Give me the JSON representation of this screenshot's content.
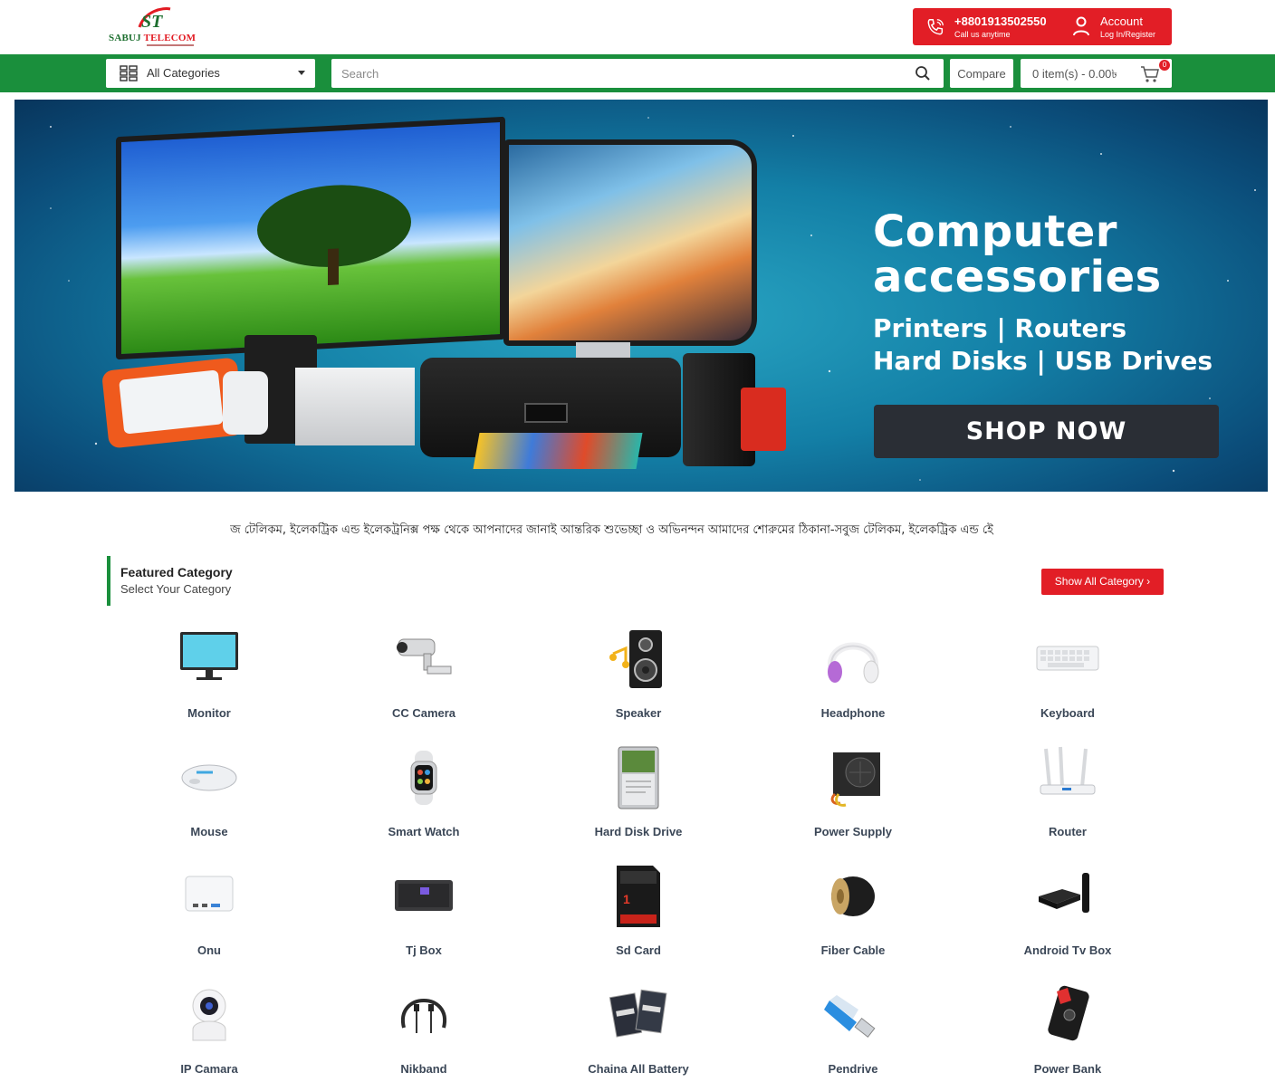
{
  "header": {
    "logo_text_1": "SABUJ",
    "logo_text_2": "TELECOM",
    "phone": "+8801913502550",
    "phone_sub": "Call us anytime",
    "account_label": "Account",
    "account_sub": "Log In/Register"
  },
  "nav": {
    "category_select": "All Categories",
    "search_placeholder": "Search",
    "compare_label": "Compare",
    "cart_text": "0 item(s) - 0.00৳",
    "cart_badge": "0"
  },
  "banner": {
    "title_line1": "Computer",
    "title_line2": "accessories",
    "sub_line1": "Printers | Routers",
    "sub_line2": "Hard Disks | USB Drives",
    "cta": "SHOP NOW"
  },
  "marquee": "জ টেলিকম, ইলেকট্রিক এন্ড ইলেকট্রনিক্স পক্ষ থেকে আপনাদের জানাই আন্তরিক শুভেচ্ছা ও অভিনন্দন আমাদের শোরুমের ঠিকানা-সবুজ টেলিকম, ইলেকট্রিক এন্ড ইে",
  "featured": {
    "title": "Featured Category",
    "subtitle": "Select Your Category",
    "show_all": "Show All Category ›"
  },
  "categories": [
    {
      "label": "Monitor",
      "icon": "monitor-icon"
    },
    {
      "label": "CC Camera",
      "icon": "cc-camera-icon"
    },
    {
      "label": "Speaker",
      "icon": "speaker-icon"
    },
    {
      "label": "Headphone",
      "icon": "headphone-icon"
    },
    {
      "label": "Keyboard",
      "icon": "keyboard-icon"
    },
    {
      "label": "Mouse",
      "icon": "mouse-icon"
    },
    {
      "label": "Smart Watch",
      "icon": "smart-watch-icon"
    },
    {
      "label": "Hard Disk Drive",
      "icon": "hard-disk-icon"
    },
    {
      "label": "Power Supply",
      "icon": "power-supply-icon"
    },
    {
      "label": "Router",
      "icon": "router-icon"
    },
    {
      "label": "Onu",
      "icon": "onu-icon"
    },
    {
      "label": "Tj Box",
      "icon": "tj-box-icon"
    },
    {
      "label": "Sd Card",
      "icon": "sd-card-icon"
    },
    {
      "label": "Fiber Cable",
      "icon": "fiber-cable-icon"
    },
    {
      "label": "Android Tv Box",
      "icon": "android-tv-box-icon"
    },
    {
      "label": "IP Camara",
      "icon": "ip-camera-icon"
    },
    {
      "label": "Nikband",
      "icon": "neckband-icon"
    },
    {
      "label": "Chaina All Battery",
      "icon": "battery-icon"
    },
    {
      "label": "Pendrive",
      "icon": "pendrive-icon"
    },
    {
      "label": "Power Bank",
      "icon": "power-bank-icon"
    }
  ],
  "colors": {
    "brand_green": "#1a8f3c",
    "brand_red": "#e21e26"
  }
}
